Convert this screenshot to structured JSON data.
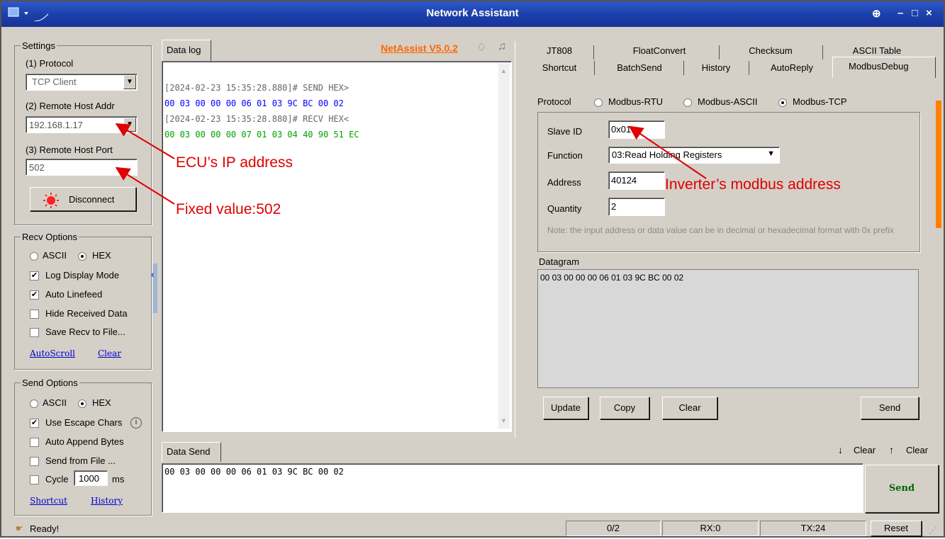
{
  "window": {
    "title": "Network Assistant"
  },
  "settings": {
    "title": "Settings",
    "protocol_label": "(1) Protocol",
    "protocol_value": "TCP Client",
    "host_label": "(2) Remote Host Addr",
    "host_value": "192.168.1.17",
    "port_label": "(3) Remote Host Port",
    "port_value": "502",
    "disconnect_label": "Disconnect"
  },
  "recv_options": {
    "title": "Recv Options",
    "ascii": "ASCII",
    "hex": "HEX",
    "log_display": "Log Display Mode",
    "auto_linefeed": "Auto Linefeed",
    "hide_received": "Hide Received Data",
    "save_recv": "Save Recv to File...",
    "autoscroll": "AutoScroll",
    "clear": "Clear"
  },
  "send_options": {
    "title": "Send Options",
    "ascii": "ASCII",
    "hex": "HEX",
    "use_escape": "Use Escape Chars",
    "auto_append": "Auto Append Bytes",
    "send_from_file": "Send from File ...",
    "cycle": "Cycle",
    "cycle_value": "1000",
    "cycle_unit": "ms",
    "shortcut": "Shortcut",
    "history": "History"
  },
  "data_log": {
    "tab": "Data log",
    "version_link": "NetAssist V5.0.2",
    "lines": [
      "[2024-02-23 15:35:28.880]# SEND HEX>",
      "00 03 00 00 00 06 01 03 9C BC 00 02",
      "[2024-02-23 15:35:28.880]# RECV HEX<",
      "00 03 00 00 00 07 01 03 04 40 90 51 EC"
    ]
  },
  "right_tabs": {
    "row1": [
      "JT808",
      "FloatConvert",
      "Checksum",
      "ASCII Table"
    ],
    "row2": [
      "Shortcut",
      "BatchSend",
      "History",
      "AutoReply",
      "ModbusDebug"
    ]
  },
  "modbus": {
    "protocol_label": "Protocol",
    "rtu": "Modbus-RTU",
    "ascii": "Modbus-ASCII",
    "tcp": "Modbus-TCP",
    "slave_label": "Slave ID",
    "slave_value": "0x01",
    "function_label": "Function",
    "function_value": "03:Read Holding Registers",
    "address_label": "Address",
    "address_value": "40124",
    "quantity_label": "Quantity",
    "quantity_value": "2",
    "note": "Note: the input address or data value can be in decimal or hexadecimal format with  0x prefix",
    "datagram_label": "Datagram",
    "datagram_value": "00 03 00 00 00 06 01 03 9C BC 00 02",
    "update": "Update",
    "copy": "Copy",
    "clear": "Clear",
    "send": "Send"
  },
  "data_send": {
    "tab": "Data Send",
    "clear1": "Clear",
    "clear2": "Clear",
    "value": "00 03 00 00 00 06 01 03 9C BC 00 02",
    "send": "Send"
  },
  "status": {
    "ready": "Ready!",
    "count": "0/2",
    "rx": "RX:0",
    "tx": "TX:24",
    "reset": "Reset"
  },
  "annotations": {
    "ip": "ECU’s IP address",
    "port": "Fixed value:502",
    "modbus": "Inverter’s modbus address"
  },
  "colors": {
    "send_text": "#0000ff",
    "recv_text": "#00a000",
    "annotation": "#e00000",
    "title_bar": "#1b3fa8",
    "link_orange": "#ff6600",
    "send_button_green": "#006400"
  }
}
